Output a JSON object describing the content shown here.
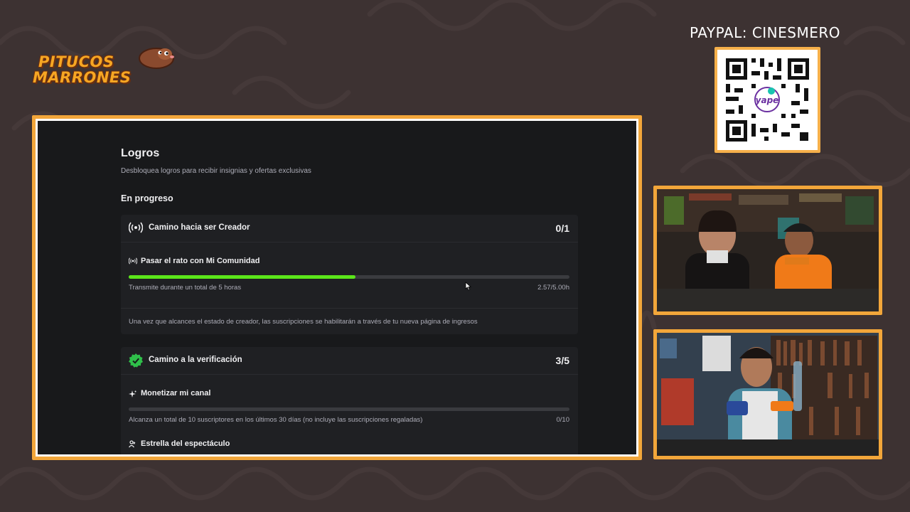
{
  "overlay": {
    "logo": {
      "line1": "PITUCOS",
      "line2": "MARRONES"
    },
    "paypal_label": "PAYPAL: CINESMERO",
    "qr_center_text": "yape",
    "colors": {
      "background": "#3d3232",
      "frame": "#f2a63a",
      "logo_orange": "#f6a623"
    }
  },
  "page": {
    "title": "Logros",
    "subtitle": "Desbloquea logros para recibir insignias y ofertas exclusivas",
    "section_title": "En progreso"
  },
  "cards": [
    {
      "title": "Camino hacia ser Creador",
      "count": "0/1",
      "icon": "broadcast-icon",
      "achievement": {
        "title": "Pasar el rato con Mi Comunidad",
        "icon": "broadcast-small-icon",
        "progress": 0.514,
        "desc": "Transmite durante un total de 5 horas",
        "value": "2.57/5.00h"
      },
      "footer": "Una vez que alcances el estado de creador, las suscripciones se habilitarán a través de tu nueva página de ingresos"
    },
    {
      "title": "Camino a la verificación",
      "count": "3/5",
      "icon": "verified-check-icon",
      "achievement": {
        "title": "Monetizar mi canal",
        "icon": "sparkle-icon",
        "progress": 0,
        "desc": "Alcanza un total de 10 suscriptores en los últimos 30 días (no incluye las suscripciones regaladas)",
        "value": "0/10"
      },
      "next_achievement": {
        "title": "Estrella del espectáculo",
        "icon": "people-icon"
      }
    }
  ],
  "colors": {
    "panel_bg": "#18191b",
    "card_bg": "#1f2023",
    "progress_green": "#5be61a",
    "verified_green": "#2fbf4a"
  }
}
